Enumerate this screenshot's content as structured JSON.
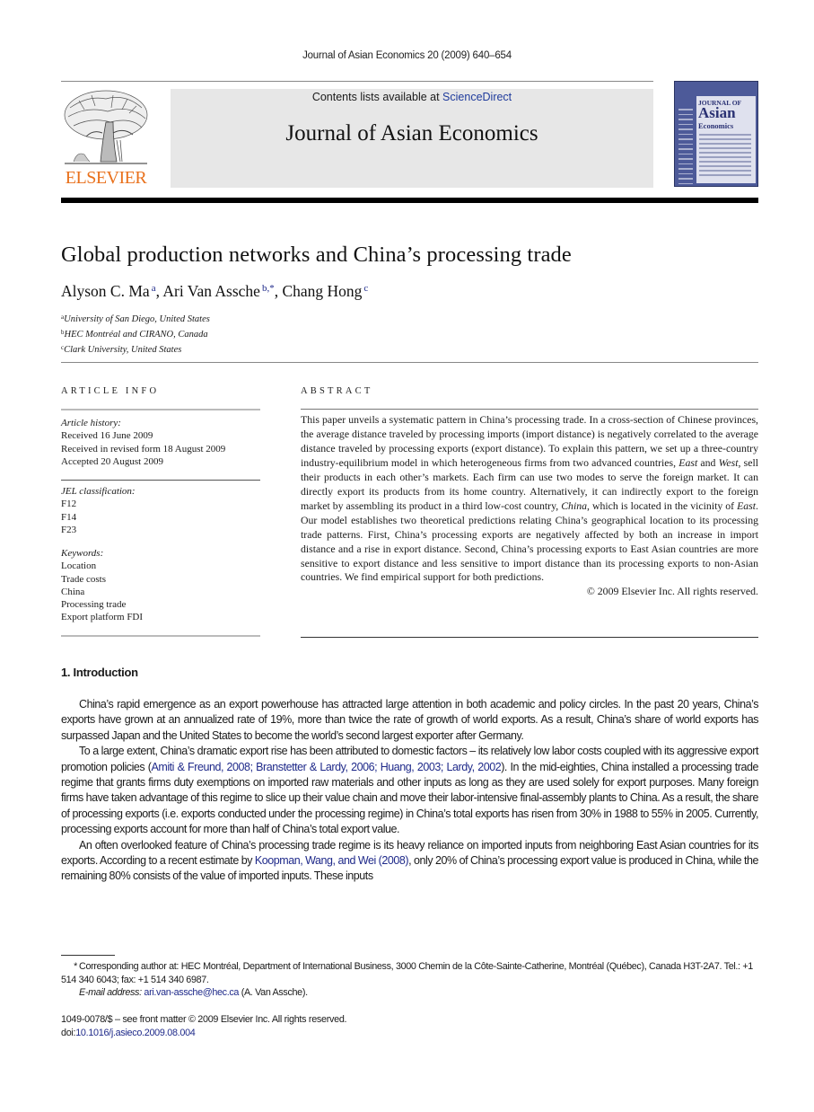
{
  "running_head": "Journal of Asian Economics 20 (2009) 640–654",
  "masthead": {
    "publisher": "ELSEVIER",
    "contents_prefix": "Contents lists available at ",
    "contents_link": "ScienceDirect",
    "journal_name": "Journal of Asian Economics",
    "cover": {
      "line1": "JOURNAL OF",
      "line2": "Asian",
      "line3": "Economics"
    }
  },
  "colors": {
    "publisher_orange": "#e9711c",
    "link_blue": "#1f2a8a",
    "cover_blue": "#4d5a99"
  },
  "article": {
    "title": "Global production networks and China’s processing trade",
    "authors": [
      {
        "name": "Alyson C. Ma",
        "sup": "a",
        "sep": ", "
      },
      {
        "name": "Ari Van Assche",
        "sup": "b,*",
        "sep": ", "
      },
      {
        "name": "Chang Hong",
        "sup": "c",
        "sep": ""
      }
    ],
    "affiliations": [
      {
        "sup": "a",
        "text": "University of San Diego, United States"
      },
      {
        "sup": "b",
        "text": "HEC Montréal and CIRANO, Canada"
      },
      {
        "sup": "c",
        "text": "Clark University, United States"
      }
    ]
  },
  "article_info": {
    "label": "ARTICLE INFO",
    "history_label": "Article history:",
    "history": [
      "Received 16 June 2009",
      "Received in revised form 18 August 2009",
      "Accepted 20 August 2009"
    ],
    "jel_label": "JEL classification:",
    "jel": [
      "F12",
      "F14",
      "F23"
    ],
    "keywords_label": "Keywords:",
    "keywords": [
      "Location",
      "Trade costs",
      "China",
      "Processing trade",
      "Export platform FDI"
    ]
  },
  "abstract": {
    "label": "ABSTRACT",
    "parts": {
      "p1": "This paper unveils a systematic pattern in China’s processing trade. In a cross-section of Chinese provinces, the average distance traveled by processing imports (import distance) is negatively correlated to the average distance traveled by processing exports (export distance). To explain this pattern, we set up a three-country industry-equilibrium model in which heterogeneous firms from two advanced countries, ",
      "east1": "East",
      "p2": " and ",
      "west": "West",
      "p3": ", sell their products in each other’s markets. Each firm can use two modes to serve the foreign market. It can directly export its products from its home country. Alternatively, it can indirectly export to the foreign market by assembling its product in a third low-cost country, ",
      "china": "China",
      "p4": ", which is located in the vicinity of ",
      "east2": "East",
      "p5": ". Our model establishes two theoretical predictions relating China’s geographical location to its processing trade patterns. First, China’s processing exports are negatively affected by both an increase in import distance and a rise in export distance. Second, China’s processing exports to East Asian countries are more sensitive to export distance and less sensitive to import distance than its processing exports to non-Asian countries. We find empirical support for both predictions."
    },
    "copyright": "© 2009 Elsevier Inc. All rights reserved."
  },
  "introduction": {
    "heading": "1.  Introduction",
    "para1": "China’s rapid emergence as an export powerhouse has attracted large attention in both academic and policy circles. In the past 20 years, China’s exports have grown at an annualized rate of 19%, more than twice the rate of growth of world exports. As a result, China’s share of world exports has surpassed Japan and the United States to become the world’s second largest exporter after Germany.",
    "para2": {
      "before": "To a large extent, China’s dramatic export rise has been attributed to domestic factors – its relatively low labor costs coupled with its aggressive export promotion policies (",
      "citations": [
        {
          "text": "Amiti & Freund, 2008",
          "sep": "; "
        },
        {
          "text": "Branstetter & Lardy, 2006",
          "sep": "; "
        },
        {
          "text": "Huang, 2003",
          "sep": "; "
        },
        {
          "text": "Lardy, 2002",
          "sep": ""
        }
      ],
      "after": "). In the mid-eighties, China installed a processing trade regime that grants firms duty exemptions on imported raw materials and other inputs as long as they are used solely for export purposes. Many foreign firms have taken advantage of this regime to slice up their value chain and move their labor-intensive final-assembly plants to China. As a result, the share of processing exports (i.e. exports conducted under the processing regime) in China’s total exports has risen from 30% in 1988 to 55% in 2005. Currently, processing exports account for more than half of China’s total export value."
    },
    "para3": {
      "before": "An often overlooked feature of China’s processing trade regime is its heavy reliance on imported inputs from neighboring East Asian countries for its exports. According to a recent estimate by ",
      "citation": "Koopman, Wang, and Wei (2008)",
      "after": ", only 20% of China’s processing export value is produced in China, while the remaining 80% consists of the value of imported inputs. These inputs"
    }
  },
  "footnotes": {
    "star": "*",
    "corresponding": "Corresponding author at: HEC Montréal, Department of International Business, 3000 Chemin de la Côte-Sainte-Catherine, Montréal (Québec), Canada H3T-2A7. Tel.: +1 514 340 6043; fax: +1 514 340 6987.",
    "email_label": "E-mail address:",
    "email": "ari.van-assche@hec.ca",
    "email_suffix": " (A. Van Assche)."
  },
  "imprint": {
    "issn_line": "1049-0078/$ – see front matter © 2009 Elsevier Inc. All rights reserved.",
    "doi_prefix": "doi:",
    "doi": "10.1016/j.asieco.2009.08.004"
  }
}
